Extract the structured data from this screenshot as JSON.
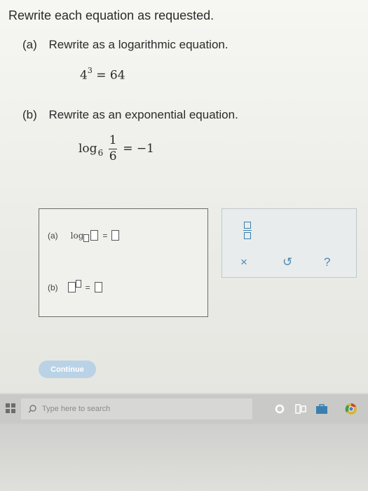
{
  "title": "Rewrite each equation as requested.",
  "part_a": {
    "label": "(a)",
    "instruction": "Rewrite as a logarithmic equation.",
    "base": "4",
    "exp": "3",
    "rhs": "= 64"
  },
  "part_b": {
    "label": "(b)",
    "instruction": "Rewrite as an exponential equation.",
    "log": "log",
    "base": "6",
    "num": "1",
    "den": "6",
    "rhs": "= −1"
  },
  "answer": {
    "label_a": "(a)",
    "log": "log",
    "eq": "=",
    "label_b": "(b)"
  },
  "tools": {
    "clear": "×",
    "undo": "↺",
    "help": "?"
  },
  "continue_label": "Continue",
  "taskbar": {
    "search_placeholder": "Type here to search"
  }
}
